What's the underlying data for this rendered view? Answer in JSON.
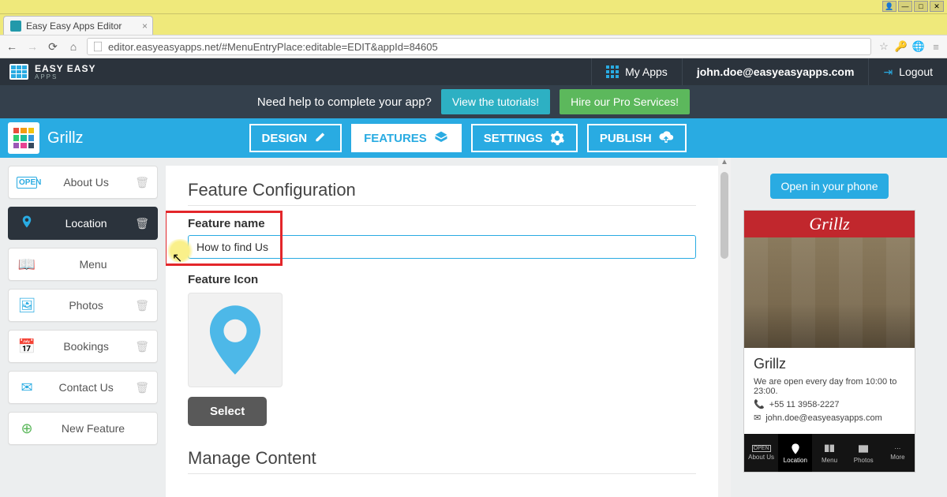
{
  "browser": {
    "tab_title": "Easy Easy Apps Editor",
    "url": "editor.easyeasyapps.net/#MenuEntryPlace:editable=EDIT&appId=84605"
  },
  "brand": {
    "line1": "EASY EASY",
    "line2": "APPS"
  },
  "topnav": {
    "my_apps": "My Apps",
    "user_email": "john.doe@easyeasyapps.com",
    "logout": "Logout"
  },
  "helpbar": {
    "prompt": "Need help to complete your app?",
    "tutorials_btn": "View the tutorials!",
    "pro_btn": "Hire our Pro Services!"
  },
  "app": {
    "name": "Grillz"
  },
  "sections": {
    "design": "DESIGN",
    "features": "FEATURES",
    "settings": "SETTINGS",
    "publish": "PUBLISH"
  },
  "sidebar": {
    "items": [
      {
        "label": "About Us"
      },
      {
        "label": "Location"
      },
      {
        "label": "Menu"
      },
      {
        "label": "Photos"
      },
      {
        "label": "Bookings"
      },
      {
        "label": "Contact Us"
      }
    ],
    "new_feature": "New Feature"
  },
  "main": {
    "heading": "Feature Configuration",
    "feature_name_label": "Feature name",
    "feature_name_value": "How to find Us",
    "feature_icon_label": "Feature Icon",
    "select_btn": "Select",
    "manage_heading": "Manage Content"
  },
  "preview": {
    "open_btn": "Open in your phone",
    "hero_title": "Grillz",
    "body_title": "Grillz",
    "hours": "We are open every day from 10:00 to 23:00.",
    "phone": "+55 11 3958-2227",
    "email": "john.doe@easyeasyapps.com",
    "tabs": [
      "About Us",
      "Location",
      "Menu",
      "Photos",
      "More"
    ]
  }
}
